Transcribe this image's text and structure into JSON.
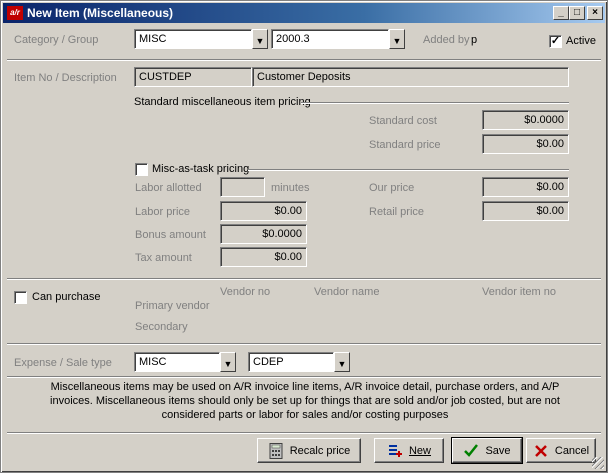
{
  "window": {
    "icon_text": "a/r",
    "title": "New Item (Miscellaneous)",
    "minimize": "_",
    "maximize": "□",
    "close": "×"
  },
  "category": {
    "label": "Category / Group",
    "category_value": "MISC",
    "group_value": "2000.3",
    "added_by_label": "Added by",
    "added_by_value": "p",
    "active_label": "Active",
    "active_checked": true
  },
  "item": {
    "label": "Item No / Description",
    "number": "CUSTDEP",
    "description": "Customer Deposits"
  },
  "standard_pricing": {
    "heading": "Standard miscellaneous item pricing",
    "cost_label": "Standard cost",
    "cost_value": "$0.0000",
    "price_label": "Standard price",
    "price_value": "$0.00"
  },
  "misc_task": {
    "label": "Misc-as-task pricing",
    "checked": false,
    "labor_allotted_label": "Labor allotted",
    "labor_allotted_value": "",
    "minutes_label": "minutes",
    "labor_price_label": "Labor price",
    "labor_price_value": "$0.00",
    "bonus_label": "Bonus amount",
    "bonus_value": "$0.0000",
    "tax_label": "Tax amount",
    "tax_value": "$0.00",
    "our_price_label": "Our price",
    "our_price_value": "$0.00",
    "retail_price_label": "Retail price",
    "retail_price_value": "$0.00"
  },
  "purchase": {
    "can_purchase_label": "Can purchase",
    "checked": false,
    "vendor_no_header": "Vendor no",
    "vendor_name_header": "Vendor name",
    "vendor_item_header": "Vendor item no",
    "primary_label": "Primary vendor",
    "secondary_label": "Secondary"
  },
  "expense": {
    "label": "Expense / Sale type",
    "expense_value": "MISC",
    "sale_type_value": "CDEP"
  },
  "note": "Miscellaneous items may be used on A/R invoice line items, A/R invoice detail, purchase orders, and A/P invoices. Miscellaneous items should only be set up for things that are sold and/or job costed, but are not considered parts or labor for sales and/or costing purposes",
  "buttons": {
    "recalc": "Recalc price",
    "new": "New",
    "save": "Save",
    "cancel": "Cancel"
  },
  "colors": {
    "title_bar": "#0a246a",
    "face": "#d4d0c8",
    "disabled_text": "#808080",
    "save_check": "#008000",
    "cancel_x": "#c00000"
  },
  "icons": [
    "app-icon",
    "dropdown-arrow-icon",
    "calculator-icon",
    "new-icon",
    "checkmark-icon",
    "cancel-x-icon"
  ]
}
